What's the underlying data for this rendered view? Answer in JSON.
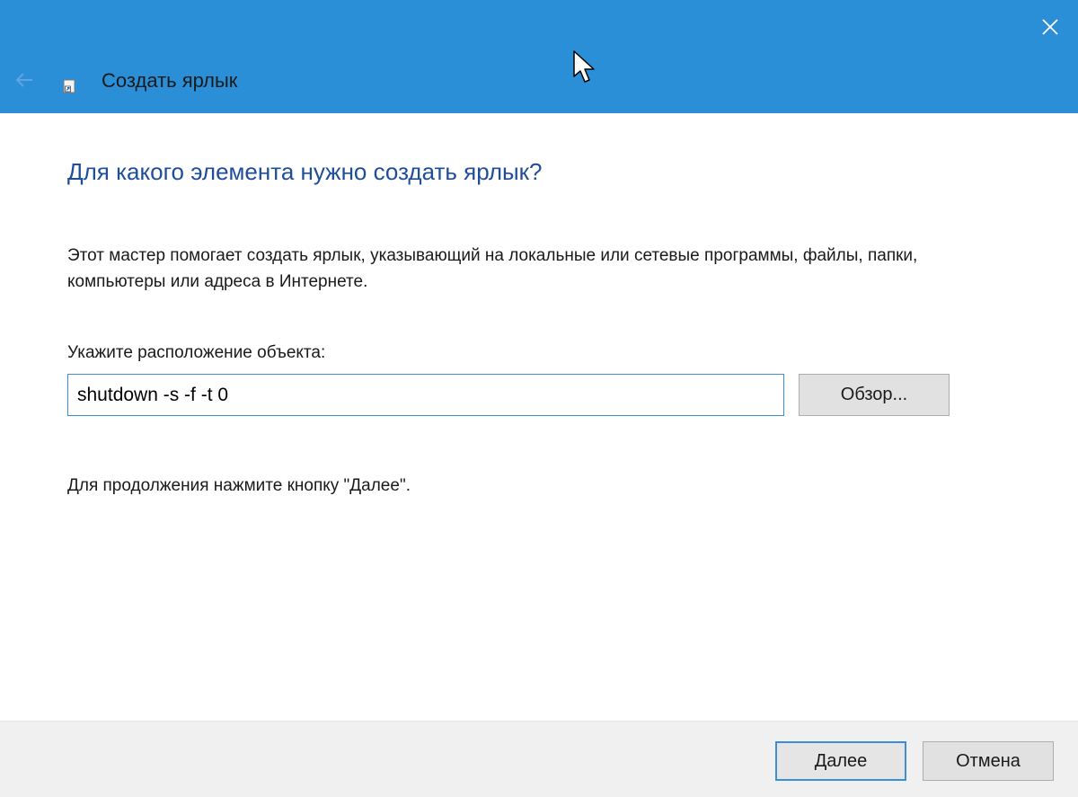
{
  "window": {
    "title": "Создать ярлык",
    "accent_color": "#2b8fd8",
    "icons": {
      "close": "close-icon",
      "back": "back-arrow-icon",
      "app": "shortcut-icon"
    }
  },
  "main": {
    "heading": "Для какого элемента нужно создать ярлык?",
    "description": "Этот мастер помогает создать ярлык, указывающий на локальные или сетевые программы, файлы, папки, компьютеры или адреса в Интернете.",
    "location_label": "Укажите расположение объекта:",
    "location_value": "shutdown -s -f -t 0",
    "browse_label": "Обзор...",
    "continue_hint": "Для продолжения нажмите кнопку \"Далее\"."
  },
  "footer": {
    "next_label": "Далее",
    "cancel_label": "Отмена"
  }
}
